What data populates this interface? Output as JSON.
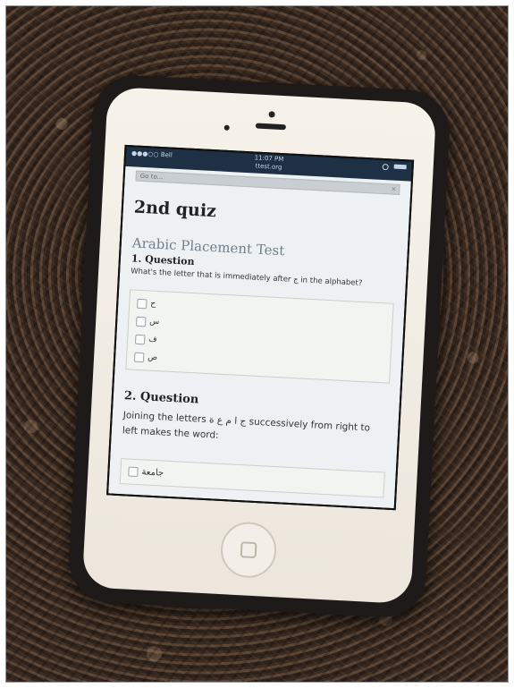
{
  "status_bar": {
    "carrier": "●●●○○ Bell",
    "time": "11:07 PM",
    "url": "ttest.org"
  },
  "goto": {
    "placeholder": "Go to...",
    "close": "✕"
  },
  "quiz": {
    "title": "2nd quiz",
    "test_name": "Arabic Placement Test"
  },
  "question1": {
    "heading": "1. Question",
    "text": "What's the letter that is immediately after ج in the alphabet?",
    "options": [
      "ح",
      "س",
      "ف",
      "ص"
    ]
  },
  "question2": {
    "heading": "2. Question",
    "text": "Joining the letters ج ا م ع ة successively from right to left makes the word:",
    "options": [
      "جامعة"
    ]
  },
  "icons": {
    "home_button": "home-square-icon"
  }
}
